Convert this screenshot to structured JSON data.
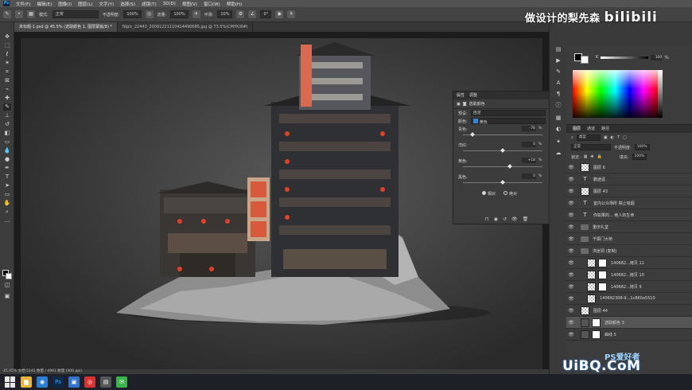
{
  "app": {
    "logo": "Ps",
    "menu": [
      "文件(F)",
      "编辑(E)",
      "图像(I)",
      "图层(L)",
      "文字(Y)",
      "选择(S)",
      "滤镜(T)",
      "3D(D)",
      "视图(V)",
      "窗口(W)",
      "帮助(H)"
    ]
  },
  "options": {
    "mode_label": "模式:",
    "mode_value": "正常",
    "opacity_label": "不透明度:",
    "opacity_value": "100%",
    "flow_label": "流量:",
    "flow_value": "100%",
    "smooth_label": "平滑:",
    "smooth_value": "10%",
    "angle_value": "0°"
  },
  "tabs": [
    {
      "label": "未标题-1.psd @ 45.5% (选取颜色 1, 图层蒙版/8) *",
      "active": true
    },
    {
      "label": "Nipic_22443_20091221110414490685.jpg @ 73.5%(CMYK/8#)",
      "active": false
    }
  ],
  "status": "45.45%    文档:5142 数量 / 4961 数量 (300 ppi)",
  "watermark": {
    "text": "做设计的梨先森",
    "site": "bilibili"
  },
  "properties": {
    "tabs": [
      "属性",
      "调整"
    ],
    "title": "选取颜色",
    "preset_label": "预设:",
    "preset_value": "自定",
    "colors_label": "颜色:",
    "colors_value": "黄色",
    "sliders": [
      {
        "label": "青色:",
        "value": "-76",
        "level": -76
      },
      {
        "label": "洋红:",
        "value": "0",
        "level": 0
      },
      {
        "label": "黄色:",
        "value": "+18",
        "level": 18
      },
      {
        "label": "黑色:",
        "value": "0",
        "level": 0
      }
    ],
    "pct": "%",
    "method_relative": "相对",
    "method_absolute": "绝对"
  },
  "color_panel": {
    "channel": "K",
    "value": "100",
    "pct": "%"
  },
  "layers": {
    "tabs": [
      "图层",
      "通道",
      "路径"
    ],
    "kind_label": "类型",
    "blend_value": "正常",
    "opacity_label": "不透明度:",
    "opacity_value": "100%",
    "lock_label": "锁定:",
    "fill_label": "填充:",
    "fill_value": "100%",
    "items": [
      {
        "name": "图层 6",
        "kind": "pixel",
        "indent": 0
      },
      {
        "name": "鹏逍遥",
        "kind": "text",
        "indent": 0
      },
      {
        "name": "图层 43",
        "kind": "pixel",
        "indent": 0
      },
      {
        "name": "室内公众场所 禁止吸烟",
        "kind": "text",
        "indent": 0
      },
      {
        "name": "你如果的... 绝人的生命",
        "kind": "text",
        "indent": 0
      },
      {
        "name": "重庆礼堂",
        "kind": "folder",
        "indent": 0
      },
      {
        "name": "千厮门大桥",
        "kind": "folder",
        "indent": 0
      },
      {
        "name": "洪崖洞 (复制)",
        "kind": "folder",
        "indent": 0
      },
      {
        "name": "140682...拷贝 11",
        "kind": "pixel-mask",
        "indent": 1
      },
      {
        "name": "140682...拷贝 10",
        "kind": "pixel-mask",
        "indent": 1
      },
      {
        "name": "140682...拷贝 9",
        "kind": "pixel-mask",
        "indent": 1
      },
      {
        "name": "140682308-9...1c860a5510",
        "kind": "pixel",
        "indent": 1
      },
      {
        "name": "图层 44",
        "kind": "pixel",
        "indent": 0
      },
      {
        "name": "选取颜色 3",
        "kind": "adjust",
        "indent": 0,
        "selected": true
      },
      {
        "name": "曲线 5",
        "kind": "adjust",
        "indent": 0
      }
    ]
  },
  "footer_brand": {
    "uibq": "UiBQ.CoM",
    "psai": "PS爱好者"
  }
}
